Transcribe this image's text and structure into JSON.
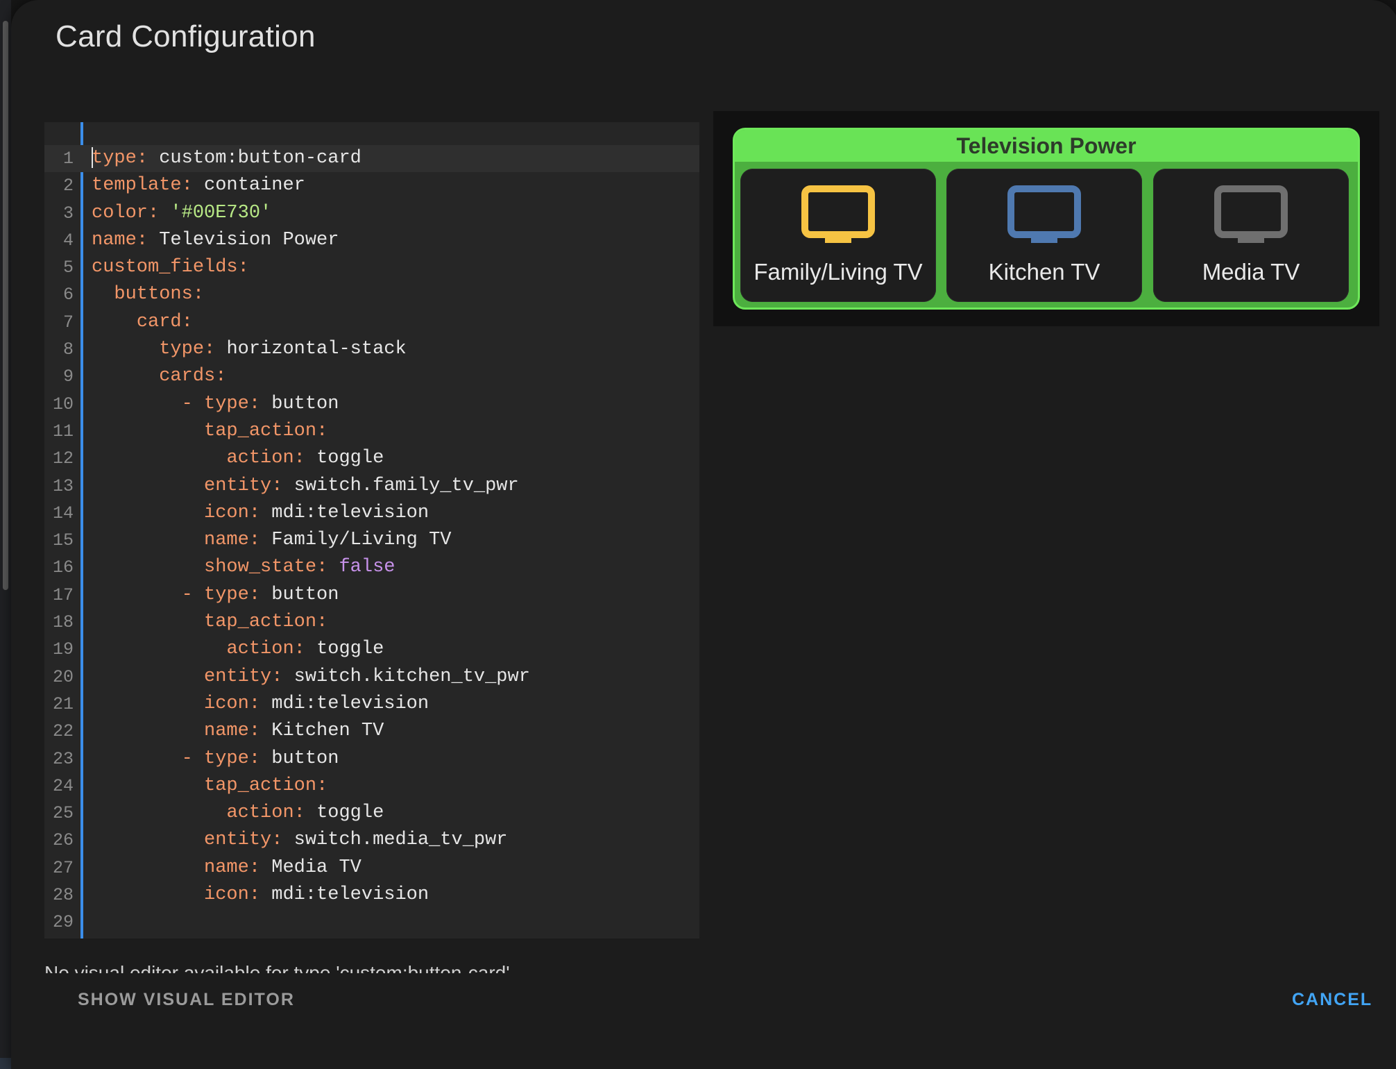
{
  "dialog": {
    "title": "Card Configuration"
  },
  "editor": {
    "lines": [
      {
        "n": "1",
        "indent": "",
        "dash": "",
        "key": "type",
        "value": "custom:button-card",
        "vclass": ""
      },
      {
        "n": "2",
        "indent": "",
        "dash": "",
        "key": "template",
        "value": "container",
        "vclass": ""
      },
      {
        "n": "3",
        "indent": "",
        "dash": "",
        "key": "color",
        "value": "'#00E730'",
        "vclass": "s"
      },
      {
        "n": "4",
        "indent": "",
        "dash": "",
        "key": "name",
        "value": "Television Power",
        "vclass": ""
      },
      {
        "n": "5",
        "indent": "",
        "dash": "",
        "key": "custom_fields",
        "value": "",
        "vclass": ""
      },
      {
        "n": "6",
        "indent": "  ",
        "dash": "",
        "key": "buttons",
        "value": "",
        "vclass": ""
      },
      {
        "n": "7",
        "indent": "    ",
        "dash": "",
        "key": "card",
        "value": "",
        "vclass": ""
      },
      {
        "n": "8",
        "indent": "      ",
        "dash": "",
        "key": "type",
        "value": "horizontal-stack",
        "vclass": ""
      },
      {
        "n": "9",
        "indent": "      ",
        "dash": "",
        "key": "cards",
        "value": "",
        "vclass": ""
      },
      {
        "n": "10",
        "indent": "        ",
        "dash": "- ",
        "key": "type",
        "value": "button",
        "vclass": ""
      },
      {
        "n": "11",
        "indent": "          ",
        "dash": "",
        "key": "tap_action",
        "value": "",
        "vclass": ""
      },
      {
        "n": "12",
        "indent": "            ",
        "dash": "",
        "key": "action",
        "value": "toggle",
        "vclass": ""
      },
      {
        "n": "13",
        "indent": "          ",
        "dash": "",
        "key": "entity",
        "value": "switch.family_tv_pwr",
        "vclass": ""
      },
      {
        "n": "14",
        "indent": "          ",
        "dash": "",
        "key": "icon",
        "value": "mdi:television",
        "vclass": ""
      },
      {
        "n": "15",
        "indent": "          ",
        "dash": "",
        "key": "name",
        "value": "Family/Living TV",
        "vclass": ""
      },
      {
        "n": "16",
        "indent": "          ",
        "dash": "",
        "key": "show_state",
        "value": "false",
        "vclass": "b"
      },
      {
        "n": "17",
        "indent": "        ",
        "dash": "- ",
        "key": "type",
        "value": "button",
        "vclass": ""
      },
      {
        "n": "18",
        "indent": "          ",
        "dash": "",
        "key": "tap_action",
        "value": "",
        "vclass": ""
      },
      {
        "n": "19",
        "indent": "            ",
        "dash": "",
        "key": "action",
        "value": "toggle",
        "vclass": ""
      },
      {
        "n": "20",
        "indent": "          ",
        "dash": "",
        "key": "entity",
        "value": "switch.kitchen_tv_pwr",
        "vclass": ""
      },
      {
        "n": "21",
        "indent": "          ",
        "dash": "",
        "key": "icon",
        "value": "mdi:television",
        "vclass": ""
      },
      {
        "n": "22",
        "indent": "          ",
        "dash": "",
        "key": "name",
        "value": "Kitchen TV",
        "vclass": ""
      },
      {
        "n": "23",
        "indent": "        ",
        "dash": "- ",
        "key": "type",
        "value": "button",
        "vclass": ""
      },
      {
        "n": "24",
        "indent": "          ",
        "dash": "",
        "key": "tap_action",
        "value": "",
        "vclass": ""
      },
      {
        "n": "25",
        "indent": "            ",
        "dash": "",
        "key": "action",
        "value": "toggle",
        "vclass": ""
      },
      {
        "n": "26",
        "indent": "          ",
        "dash": "",
        "key": "entity",
        "value": "switch.media_tv_pwr",
        "vclass": ""
      },
      {
        "n": "27",
        "indent": "          ",
        "dash": "",
        "key": "name",
        "value": "Media TV",
        "vclass": ""
      },
      {
        "n": "28",
        "indent": "          ",
        "dash": "",
        "key": "icon",
        "value": "mdi:television",
        "vclass": ""
      },
      {
        "n": "29",
        "indent": "",
        "dash": "",
        "key": "",
        "value": "",
        "vclass": ""
      }
    ],
    "notice": "No visual editor available for type 'custom:button-card'"
  },
  "preview": {
    "container_title": "Television Power",
    "container_color": "#69e356",
    "buttons": [
      {
        "label": "Family/Living TV",
        "icon": "television-icon",
        "icon_color": "#f6c343"
      },
      {
        "label": "Kitchen TV",
        "icon": "television-icon",
        "icon_color": "#4f79b0"
      },
      {
        "label": "Media TV",
        "icon": "television-icon",
        "icon_color": "#6f6f6f"
      }
    ]
  },
  "footer": {
    "show_visual_editor": "SHOW VISUAL EDITOR",
    "cancel": "CANCEL"
  },
  "colors": {
    "accent": "#42a5f5",
    "editor_border": "#3b8eea",
    "yaml_key": "#f29668",
    "yaml_string": "#b8e986",
    "yaml_bool": "#c792ea"
  }
}
